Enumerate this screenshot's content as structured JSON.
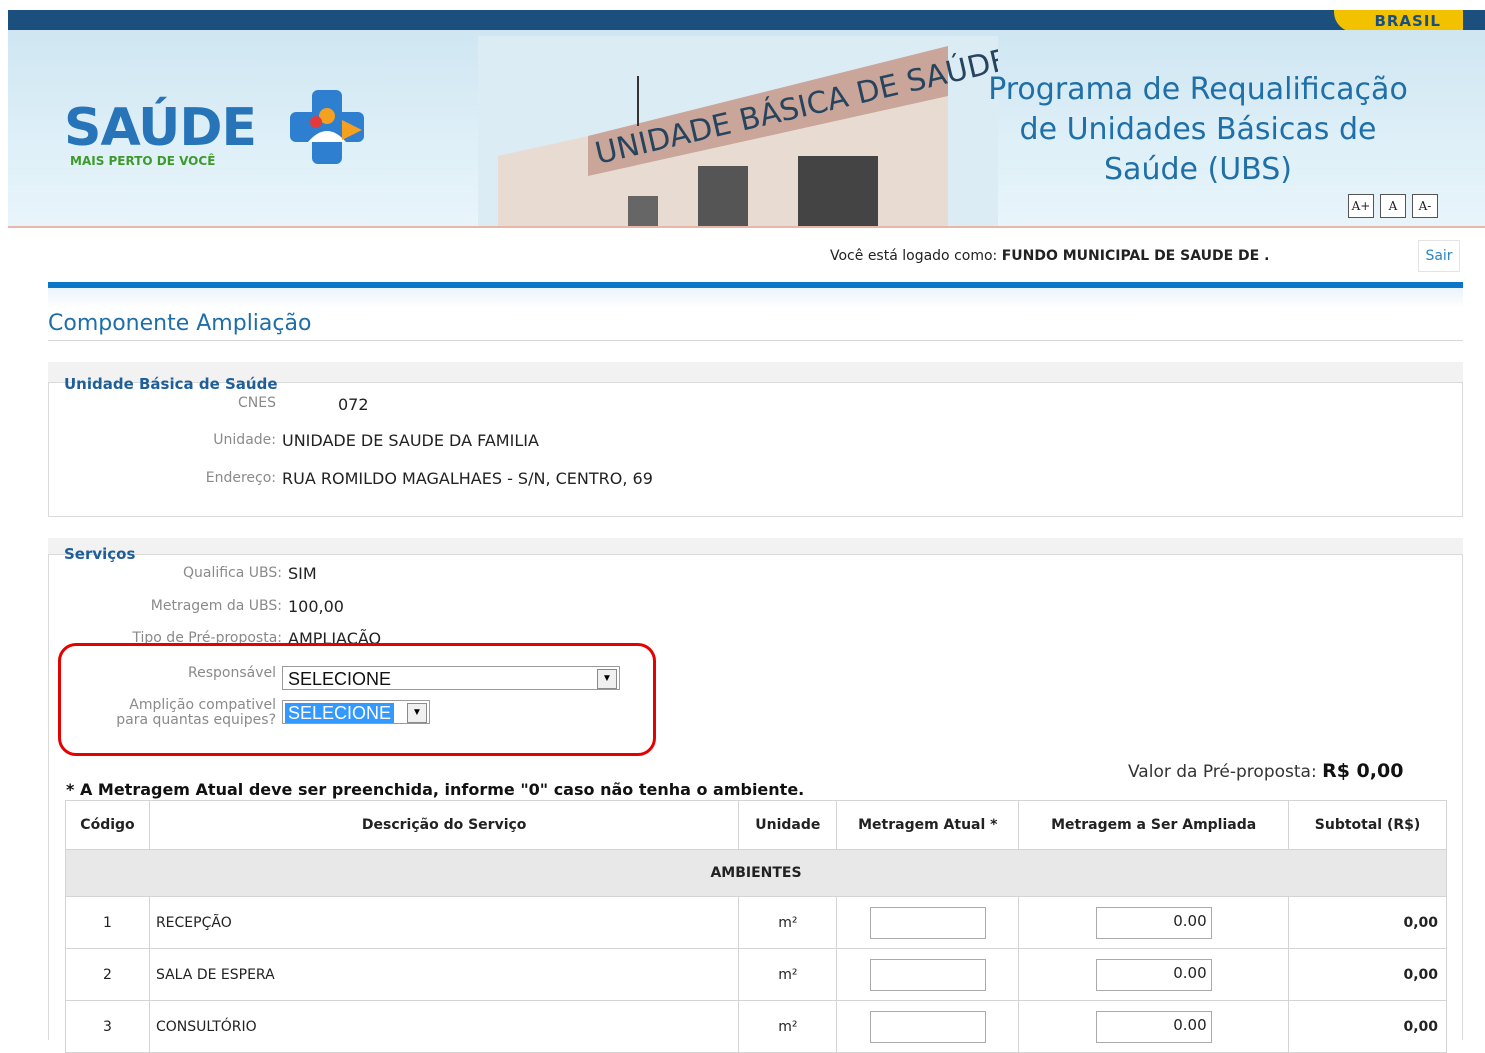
{
  "header": {
    "brasil_label": "BRASIL",
    "logo_text": "SAÚDE",
    "logo_sub": "MAIS PERTO DE VOCÊ",
    "building_sign": "UNIDADE BÁSICA DE SAÚDE",
    "program_title_1": "Programa de Requalificação",
    "program_title_2": "de Unidades Básicas de",
    "program_title_3": "Saúde (UBS)",
    "font_buttons": [
      "A+",
      "A",
      "A-"
    ]
  },
  "user": {
    "prefix": "Você está logado como: ",
    "name": "FUNDO MUNICIPAL DE SAUDE DE .",
    "logout_label": "Sair"
  },
  "page": {
    "title": "Componente Ampliação"
  },
  "ubs": {
    "legend": "Unidade Básica de Saúde",
    "cnes_label": "CNES",
    "cnes_value": "072",
    "unidade_label": "Unidade:",
    "unidade_value": "UNIDADE DE SAUDE DA FAMILIA",
    "endereco_label": "Endereço:",
    "endereco_value": "RUA ROMILDO MAGALHAES - S/N, CENTRO, 69"
  },
  "servicos": {
    "legend": "Serviços",
    "qualifica_label": "Qualifica UBS:",
    "qualifica_value": "SIM",
    "metragem_label": "Metragem da UBS:",
    "metragem_value": "100,00",
    "tipo_label": "Tipo de Pré-proposta:",
    "tipo_value": "AMPLIAÇÃO",
    "responsavel_label": "Responsável",
    "responsavel_value": "SELECIONE",
    "equipes_label_1": "Amplição compativel",
    "equipes_label_2": "para quantas equipes?",
    "equipes_value": "SELECIONE"
  },
  "valor": {
    "label": "Valor da Pré-proposta:",
    "value": "R$ 0,00"
  },
  "note": "* A Metragem Atual deve ser preenchida, informe \"0\" caso não tenha o ambiente.",
  "table": {
    "headers": [
      "Código",
      "Descrição do Serviço",
      "Unidade",
      "Metragem Atual *",
      "Metragem a Ser Ampliada",
      "Subtotal (R$)"
    ],
    "group": "AMBIENTES",
    "rows": [
      {
        "code": "1",
        "desc": "RECEPÇÃO",
        "unit": "m²",
        "atual": "",
        "ampliada": "0.00",
        "subtotal": "0,00"
      },
      {
        "code": "2",
        "desc": "SALA DE ESPERA",
        "unit": "m²",
        "atual": "",
        "ampliada": "0.00",
        "subtotal": "0,00"
      },
      {
        "code": "3",
        "desc": "CONSULTÓRIO",
        "unit": "m²",
        "atual": "",
        "ampliada": "0.00",
        "subtotal": "0,00"
      }
    ]
  },
  "colors": {
    "brand_blue": "#1e6ea8",
    "top_bar": "#1b4f7d",
    "highlight_red": "#e60000",
    "brasil_yellow": "#f2c200"
  }
}
